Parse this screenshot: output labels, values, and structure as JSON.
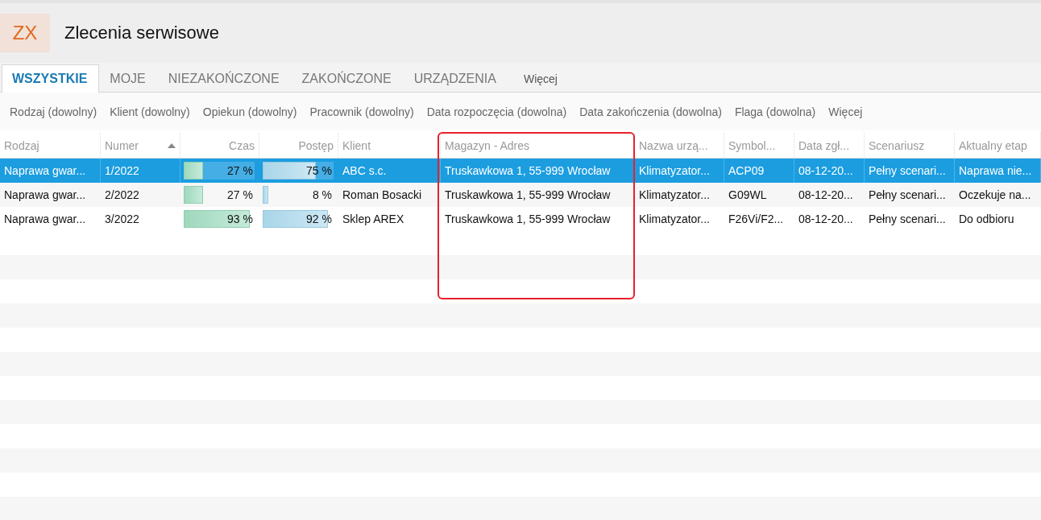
{
  "app": {
    "logo": "ZX",
    "title": "Zlecenia serwisowe"
  },
  "tabs": [
    {
      "label": "WSZYSTKIE",
      "selected": true
    },
    {
      "label": "MOJE",
      "selected": false
    },
    {
      "label": "NIEZAKOŃCZONE",
      "selected": false
    },
    {
      "label": "ZAKOŃCZONE",
      "selected": false
    },
    {
      "label": "URZĄDZENIA",
      "selected": false
    },
    {
      "label": "Więcej",
      "selected": false
    }
  ],
  "filters": [
    "Rodzaj (dowolny)",
    "Klient (dowolny)",
    "Opiekun (dowolny)",
    "Pracownik (dowolny)",
    "Data rozpoczęcia (dowolna)",
    "Data zakończenia (dowolna)",
    "Flaga (dowolna)",
    "Więcej"
  ],
  "table": {
    "columns": [
      {
        "label": "Rodzaj",
        "sorted": false,
        "highlighted": false
      },
      {
        "label": "Numer",
        "sorted": true,
        "highlighted": false
      },
      {
        "label": "Czas",
        "sorted": false,
        "highlighted": false
      },
      {
        "label": "Postęp",
        "sorted": false,
        "highlighted": false
      },
      {
        "label": "Klient",
        "sorted": false,
        "highlighted": false
      },
      {
        "label": "Magazyn - Adres",
        "sorted": false,
        "highlighted": true
      },
      {
        "label": "Nazwa urzą...",
        "sorted": false,
        "highlighted": false
      },
      {
        "label": "Symbol...",
        "sorted": false,
        "highlighted": false
      },
      {
        "label": "Data zgł...",
        "sorted": false,
        "highlighted": false
      },
      {
        "label": "Scenariusz",
        "sorted": false,
        "highlighted": false
      },
      {
        "label": "Aktualny etap",
        "sorted": false,
        "highlighted": false
      }
    ],
    "rows": [
      {
        "selected": true,
        "rodzaj": "Naprawa gwar...",
        "numer": "1/2022",
        "czas": {
          "level": 0.27,
          "text": "27 %"
        },
        "postep": {
          "level": 0.75,
          "text": "75 %"
        },
        "klient": "ABC s.c.",
        "adres": "Truskawkowa 1, 55-999 Wrocław",
        "nazwa": "Klimatyzator...",
        "symbol": "ACP09",
        "data": "08-12-20...",
        "scenariusz": "Pełny scenari...",
        "etap": "Naprawa nie..."
      },
      {
        "selected": false,
        "rodzaj": "Naprawa gwar...",
        "numer": "2/2022",
        "czas": {
          "level": 0.27,
          "text": "27 %"
        },
        "postep": {
          "level": 0.08,
          "text": "8 %"
        },
        "klient": "Roman Bosacki",
        "adres": "Truskawkowa 1, 55-999 Wrocław",
        "nazwa": "Klimatyzator...",
        "symbol": "G09WL",
        "data": "08-12-20...",
        "scenariusz": "Pełny scenari...",
        "etap": "Oczekuje na..."
      },
      {
        "selected": false,
        "rodzaj": "Naprawa gwar...",
        "numer": "3/2022",
        "czas": {
          "level": 0.93,
          "text": "93 %"
        },
        "postep": {
          "level": 0.92,
          "text": "92 %"
        },
        "klient": "Sklep AREX",
        "adres": "Truskawkowa 1, 55-999 Wrocław",
        "nazwa": "Klimatyzator...",
        "symbol": "F26Vi/F2...",
        "data": "08-12-20...",
        "scenariusz": "Pełny scenari...",
        "etap": "Do odbioru"
      }
    ]
  }
}
